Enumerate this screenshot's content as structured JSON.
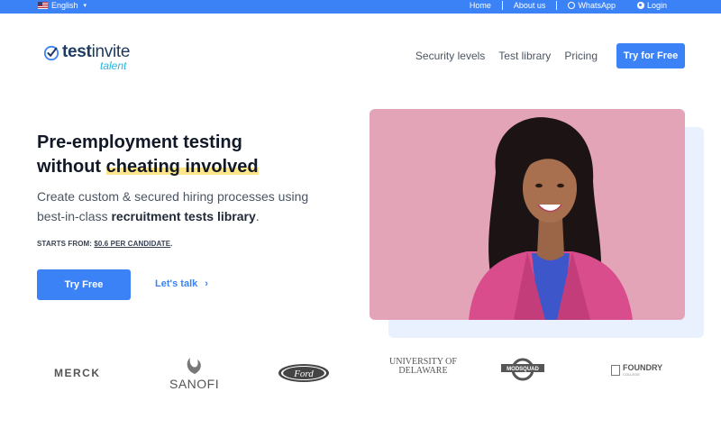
{
  "topbar": {
    "language": "English",
    "links": [
      "Home",
      "About us",
      "WhatsApp",
      "Login"
    ]
  },
  "header": {
    "logo_main_bold": "test",
    "logo_main_regular": "invite",
    "logo_sub": "talent",
    "nav": [
      "Security levels",
      "Test library",
      "Pricing"
    ],
    "cta": "Try for Free"
  },
  "hero": {
    "title_line1": "Pre-employment testing",
    "title_line2_pre": "without ",
    "title_line2_highlight": "cheating involved",
    "subtitle_pre": "Create custom & secured hiring processes using best-in-class ",
    "subtitle_bold": "recruitment tests library",
    "subtitle_post": ".",
    "price_label": "STARTS FROM: ",
    "price_value": "$0.6 PER CANDIDATE",
    "price_post": ".",
    "primary_button": "Try Free",
    "secondary_link": "Let's talk",
    "chevron": "›"
  },
  "logos": {
    "merck": "MERCK",
    "sanofi": "SANOFI",
    "ford": "Ford",
    "udel_line1": "UNIVERSITY OF",
    "udel_line2": "DELAWARE",
    "modsquad": "MODSQUAD",
    "foundry": "FOUNDRY",
    "foundry_sub": "COLLEGE"
  },
  "colors": {
    "primary": "#3b82f6",
    "highlight": "#fde68a",
    "photo_bg": "#e3a4b7",
    "logo_accent": "#22b8e0"
  }
}
